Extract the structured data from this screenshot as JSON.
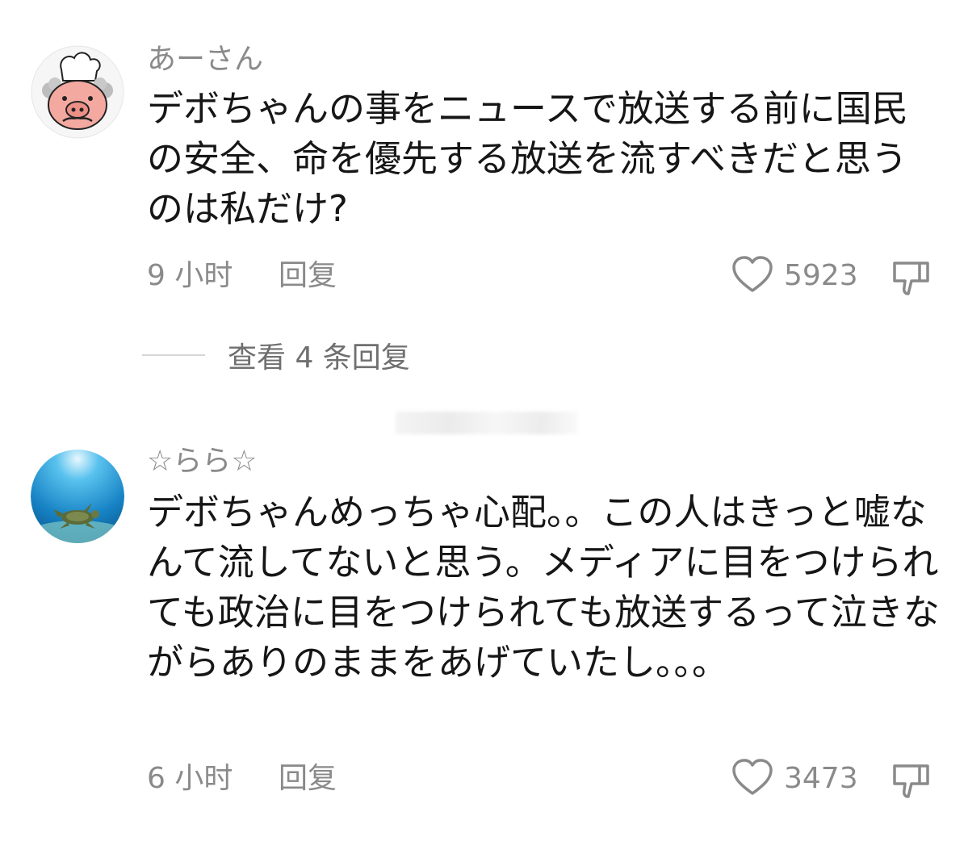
{
  "comments": [
    {
      "username": "あーさん",
      "text": "デボちゃんの事をニュースで放送する前に国民の安全、命を優先する放送を流すべきだと思うのは私だけ?",
      "time": "9 小时",
      "reply_label": "回复",
      "likes": "5923",
      "avatar_icon": "chef-pig-avatar"
    },
    {
      "username": "☆らら☆",
      "text": "デボちゃんめっちゃ心配。。この人はきっと嘘なんて流してないと思う。メディアに目をつけられても政治に目をつけられても放送するって泣きながらありのままをあげていたし。。。",
      "time": "6 小时",
      "reply_label": "回复",
      "likes": "3473",
      "avatar_icon": "sea-turtle-avatar"
    }
  ],
  "view_replies_label": "查看 4 条回复",
  "colors": {
    "text": "#161616",
    "muted": "#8a8a8a",
    "divider": "#d6d6d6"
  }
}
